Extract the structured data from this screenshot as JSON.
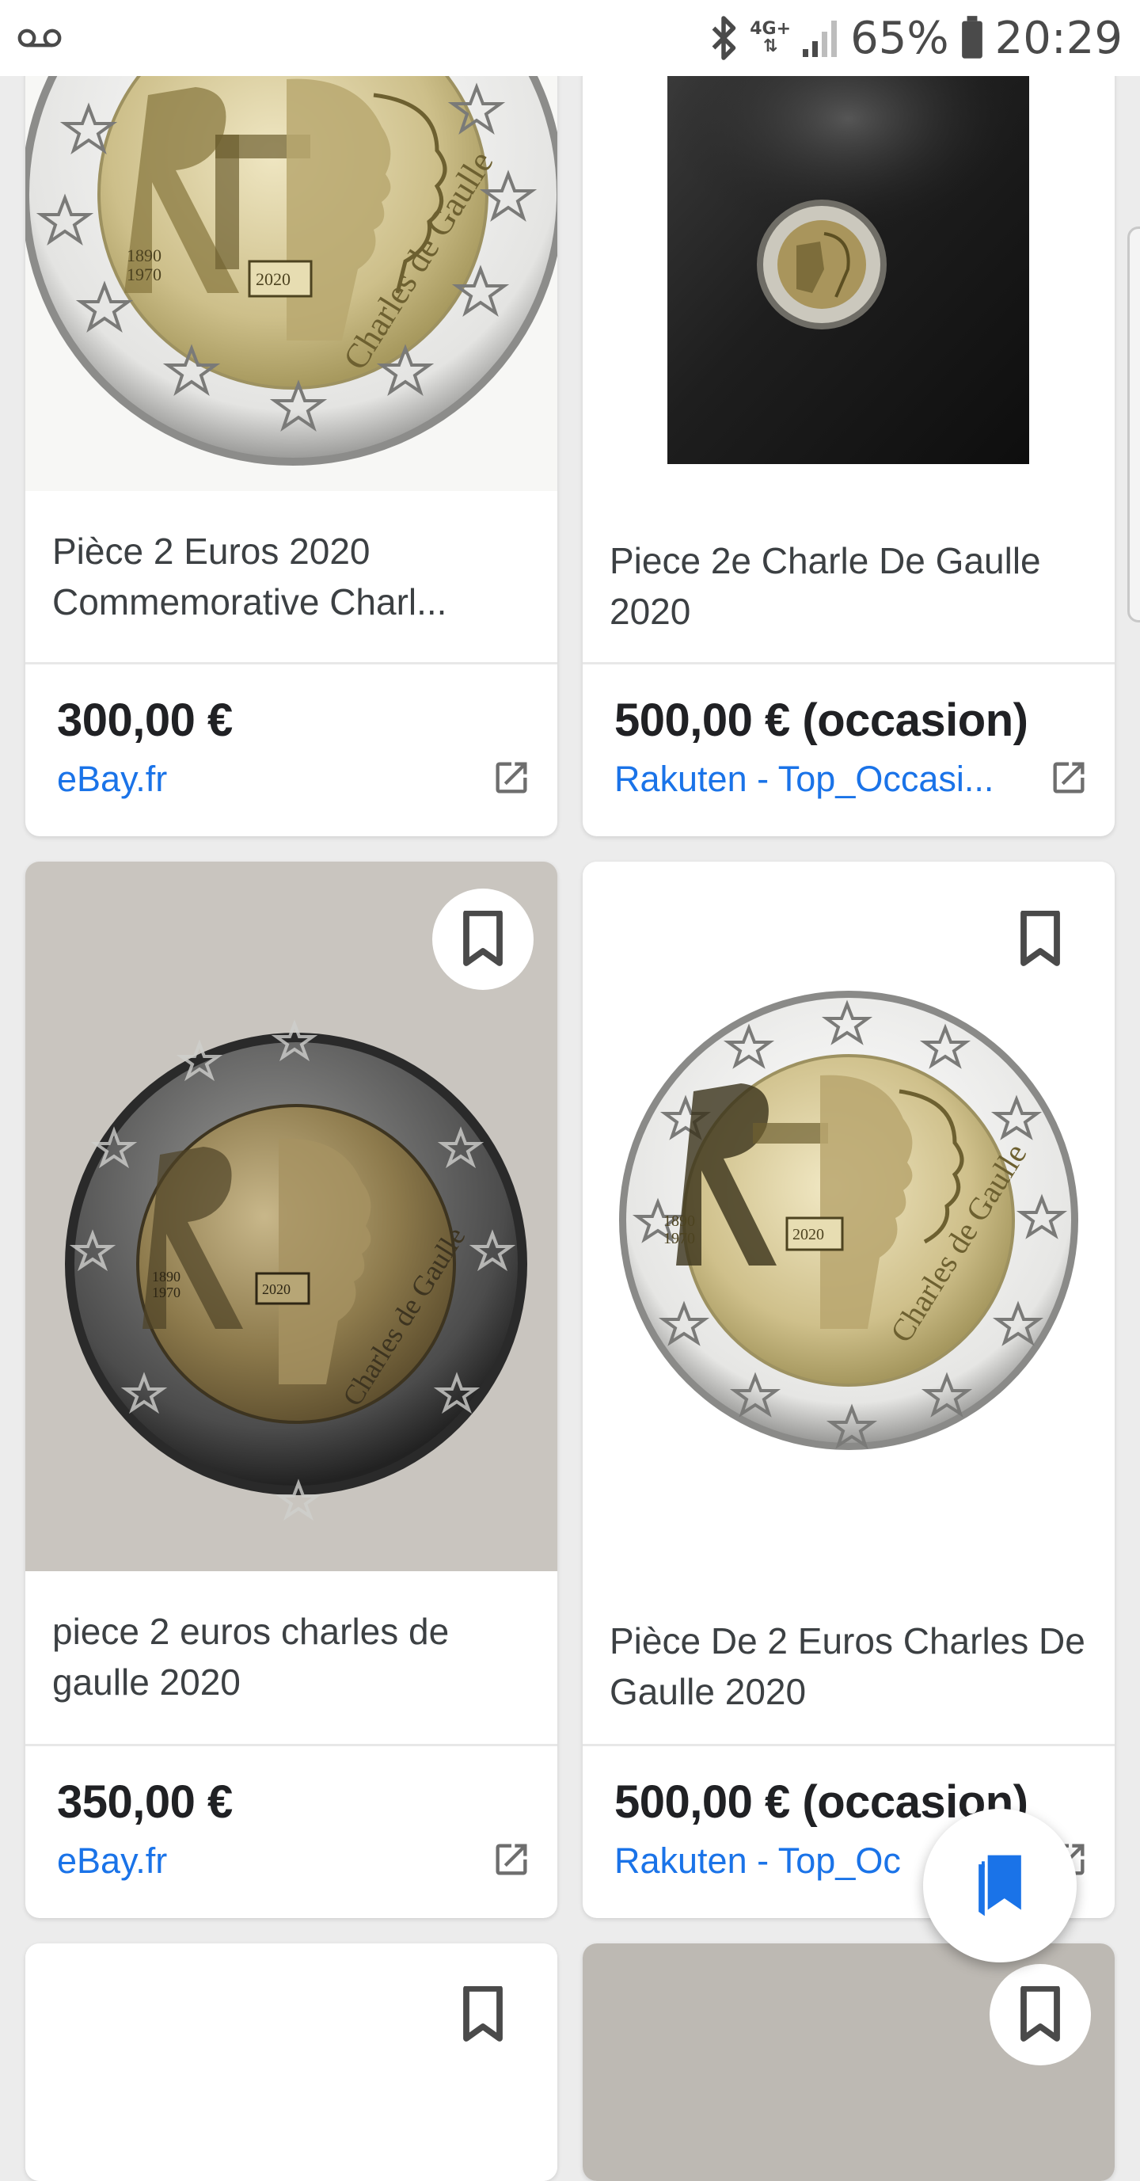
{
  "status_bar": {
    "battery": "65%",
    "time": "20:29",
    "network": "4G+",
    "icons": [
      "voicemail-icon",
      "bluetooth-icon",
      "network-4g-icon",
      "signal-icon",
      "battery-icon"
    ]
  },
  "results": [
    {
      "title": "Pièce 2 Euros 2020 Commemorative Charl...",
      "price": "300,00 €",
      "source": "eBay.fr"
    },
    {
      "title": "Piece 2e Charle De Gaulle 2020",
      "price": "500,00 € (occasion)",
      "source": "Rakuten - Top_Occasi..."
    },
    {
      "title": "piece 2 euros charles de gaulle 2020",
      "price": "350,00 €",
      "source": "eBay.fr"
    },
    {
      "title": "Pièce De 2 Euros Charles De Gaulle 2020",
      "price": "500,00 € (occasion)",
      "source": "Rakuten - Top_Oc"
    }
  ],
  "coin": {
    "years": "1890\n1970",
    "year": "2020",
    "name": "Charles de Gaulle"
  },
  "colors": {
    "link": "#1a73e8",
    "price": "#202124",
    "title": "#3c4043",
    "background": "#ececec"
  }
}
